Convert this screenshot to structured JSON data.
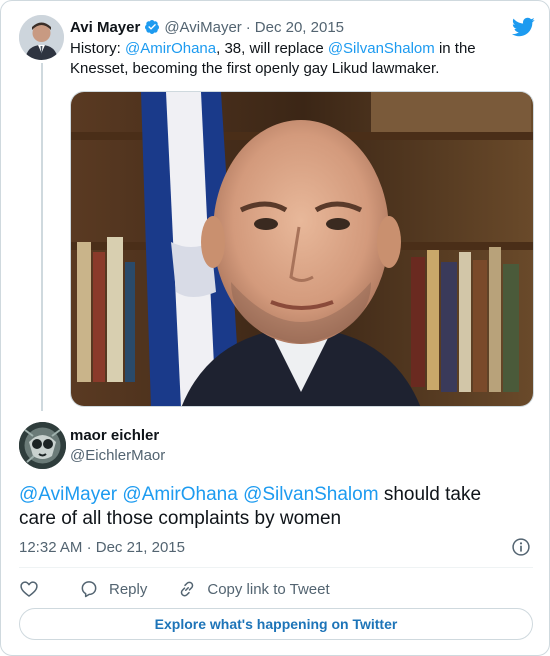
{
  "parent_tweet": {
    "author_name": "Avi Mayer",
    "handle": "@AviMayer",
    "separator": "·",
    "date": "Dec 20, 2015",
    "text_parts": [
      {
        "text": "History: ",
        "mention": false
      },
      {
        "text": "@AmirOhana",
        "mention": true
      },
      {
        "text": ", 38, will replace ",
        "mention": false
      },
      {
        "text": "@SilvanShalom",
        "mention": true
      },
      {
        "text": " in the Knesset, becoming the first openly gay Likud lawmaker.",
        "mention": false
      }
    ],
    "verified": true
  },
  "tweet": {
    "author_name": "maor eichler",
    "handle": "@EichlerMaor",
    "text_parts": [
      {
        "text": "@AviMayer",
        "mention": true
      },
      {
        "text": " ",
        "mention": false
      },
      {
        "text": "@AmirOhana",
        "mention": true
      },
      {
        "text": " ",
        "mention": false
      },
      {
        "text": "@SilvanShalom",
        "mention": true
      },
      {
        "text": " should take care of all those complaints by women",
        "mention": false
      }
    ],
    "time": "12:32 AM",
    "separator": "·",
    "date": "Dec 21, 2015"
  },
  "actions": {
    "reply_label": "Reply",
    "copy_link_label": "Copy link to Tweet"
  },
  "footer": {
    "explore_label": "Explore what's happening on Twitter"
  },
  "colors": {
    "accent": "#1d9bf0",
    "muted": "#536471",
    "border": "#cfd9de",
    "explore_text": "#1d74b8"
  },
  "icons": {
    "brand": "twitter-bird-icon",
    "verified": "verified-badge-icon",
    "info": "info-icon",
    "like": "heart-icon",
    "reply": "speech-bubble-icon",
    "copy_link": "link-icon"
  }
}
